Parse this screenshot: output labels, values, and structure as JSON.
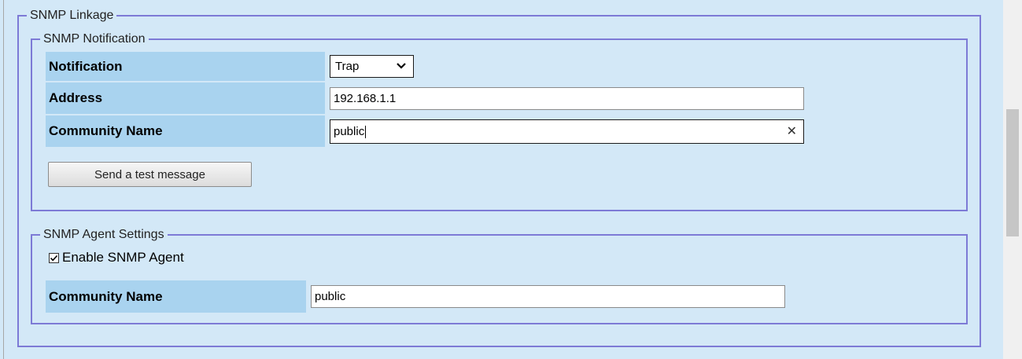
{
  "linkage": {
    "legend": "SNMP Linkage"
  },
  "notification": {
    "legend": "SNMP Notification",
    "rows": {
      "notification_label": "Notification",
      "notification_value": "Trap",
      "address_label": "Address",
      "address_value": "192.168.1.1",
      "community_label": "Community Name",
      "community_value": "public"
    },
    "test_button_label": "Send a test message"
  },
  "agent": {
    "legend": "SNMP Agent Settings",
    "enable_label": "Enable SNMP Agent",
    "enable_checked": true,
    "community_label": "Community Name",
    "community_value": "public"
  },
  "colors": {
    "panel_bg": "#d3e8f7",
    "label_bg": "#a9d3ef",
    "fieldset_border": "#7d7ad6"
  }
}
